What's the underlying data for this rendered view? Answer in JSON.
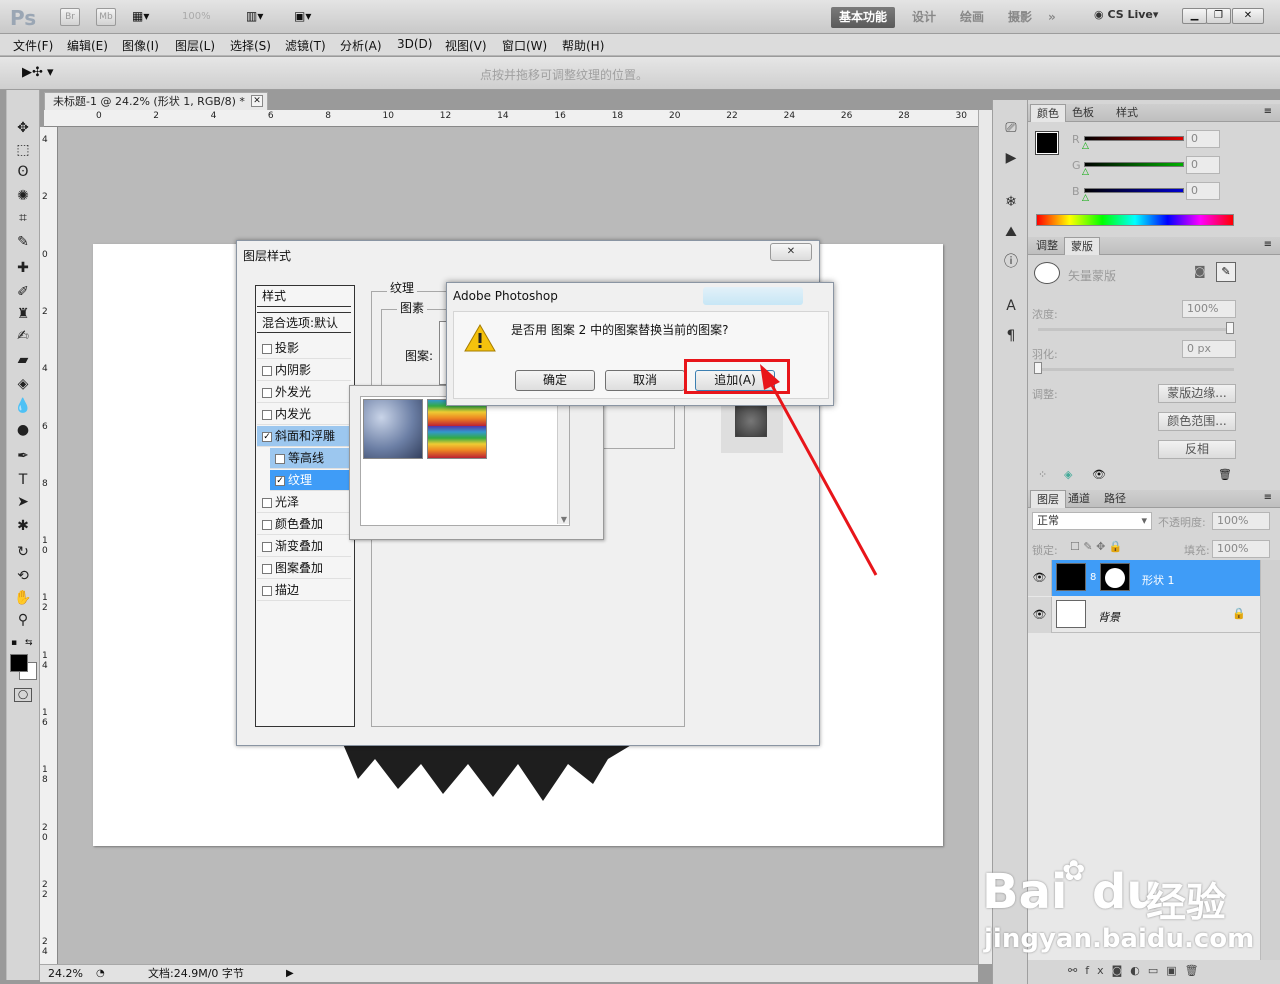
{
  "app": {
    "logo": "Ps",
    "bridge_label": "Br",
    "minibridge_label": "Mb",
    "zoom_dropdown": "100%",
    "workspaces": [
      "基本功能",
      "设计",
      "绘画",
      "摄影"
    ],
    "more": "»",
    "cslive": "CS Live"
  },
  "menu": [
    "文件(F)",
    "编辑(E)",
    "图像(I)",
    "图层(L)",
    "选择(S)",
    "滤镜(T)",
    "分析(A)",
    "3D(D)",
    "视图(V)",
    "窗口(W)",
    "帮助(H)"
  ],
  "options_bar": {
    "hint": "点按并拖移可调整纹理的位置。"
  },
  "document": {
    "tab_title": "未标题-1 @ 24.2% (形状 1, RGB/8) *",
    "ruler_top": [
      "0",
      "2",
      "4",
      "6",
      "8",
      "10",
      "12",
      "14",
      "16",
      "18",
      "20",
      "22",
      "24",
      "26",
      "28",
      "30"
    ],
    "ruler_left": [
      "4",
      "2",
      "0",
      "2",
      "4",
      "6",
      "8",
      "1 0",
      "1 2",
      "1 4",
      "1 6",
      "1 8",
      "2 0",
      "2 2",
      "2 4"
    ],
    "zoom": "24.2%",
    "doc_info": "文档:24.9M/0 字节"
  },
  "layer_style_dialog": {
    "title": "图层样式",
    "styles_header": "样式",
    "blend_options": "混合选项:默认",
    "items": [
      {
        "label": "投影",
        "checked": false
      },
      {
        "label": "内阴影",
        "checked": false
      },
      {
        "label": "外发光",
        "checked": false
      },
      {
        "label": "内发光",
        "checked": false
      },
      {
        "label": "斜面和浮雕",
        "checked": true
      },
      {
        "label": "等高线",
        "checked": false
      },
      {
        "label": "纹理",
        "checked": true
      },
      {
        "label": "光泽",
        "checked": false
      },
      {
        "label": "颜色叠加",
        "checked": false
      },
      {
        "label": "渐变叠加",
        "checked": false
      },
      {
        "label": "图案叠加",
        "checked": false
      },
      {
        "label": "描边",
        "checked": false
      }
    ],
    "group_texture": "纹理",
    "group_pattern": "图素",
    "pattern_label": "图案:",
    "ok_hidden": "确定"
  },
  "alert": {
    "title": "Adobe Photoshop",
    "message": "是否用 图案 2 中的图案替换当前的图案?",
    "buttons": {
      "ok": "确定",
      "cancel": "取消",
      "append": "追加(A)"
    }
  },
  "color_panel": {
    "tabs": [
      "颜色",
      "色板",
      "样式"
    ],
    "channels": [
      {
        "label": "R",
        "value": "0",
        "color": "#e00000"
      },
      {
        "label": "G",
        "value": "0",
        "color": "#00b000"
      },
      {
        "label": "B",
        "value": "0",
        "color": "#0000d0"
      }
    ]
  },
  "masks_panel": {
    "tabs": [
      "调整",
      "蒙版"
    ],
    "vector_mask": "矢量蒙版",
    "density_label": "浓度:",
    "density_value": "100%",
    "feather_label": "羽化:",
    "feather_value": "0 px",
    "adjust_label": "调整:",
    "buttons": [
      "蒙版边缘...",
      "颜色范围...",
      "反相"
    ]
  },
  "layers_panel": {
    "tabs": [
      "图层",
      "通道",
      "路径"
    ],
    "blend_mode": "正常",
    "opacity_label": "不透明度:",
    "opacity_value": "100%",
    "lock_label": "锁定:",
    "fill_label": "填充:",
    "fill_value": "100%",
    "layers": [
      {
        "name": "形状 1",
        "selected": true
      },
      {
        "name": "背景",
        "selected": false
      }
    ]
  },
  "watermark": {
    "brand": "Bai",
    "brand2": "du",
    "cn": "经验",
    "url": "jingyan.baidu.com"
  }
}
